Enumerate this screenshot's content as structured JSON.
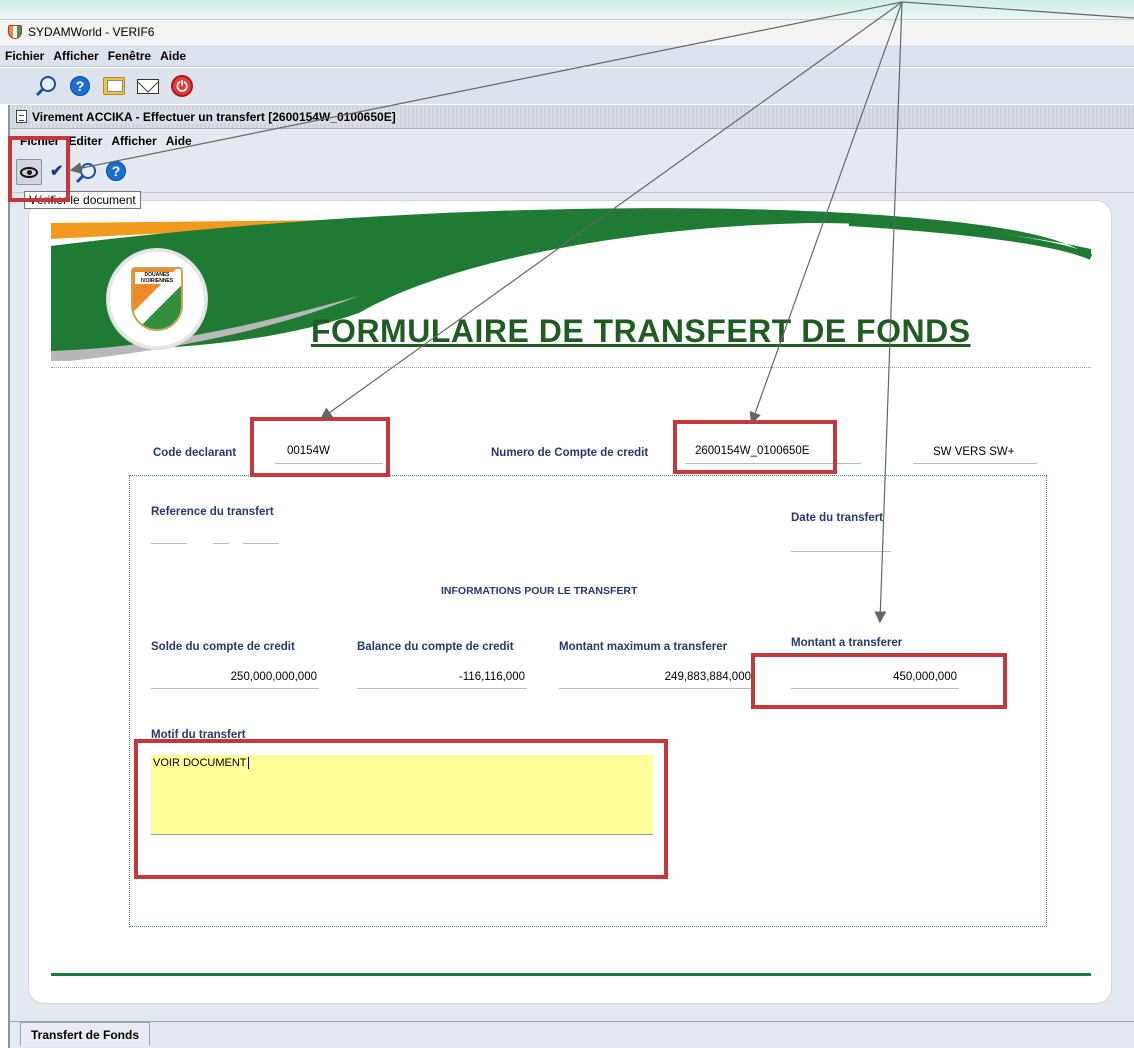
{
  "window": {
    "title": "SYDAMWorld - VERIF6"
  },
  "main_menu": {
    "items": [
      "Fichier",
      "Afficher",
      "Fenêtre",
      "Aide"
    ]
  },
  "inner_window": {
    "title": "Virement ACCIKA - Effectuer un transfert [2600154W_0100650E]",
    "menu": [
      "Fichier",
      "Editer",
      "Afficher",
      "Aide"
    ],
    "tooltip": "Vérifier le document"
  },
  "form": {
    "title": "FORMULAIRE DE TRANSFERT DE FONDS",
    "logo_text": "DOUANES IVOIRIENNES",
    "code_declarant_label": "Code declarant",
    "code_declarant_value": "00154W",
    "compte_credit_label": "Numero de Compte de credit",
    "compte_credit_value": "2600154W_0100650E",
    "sw_label": "SW VERS SW+",
    "reference_label": "Reference du transfert",
    "date_label": "Date du transfert",
    "section_header": "INFORMATIONS POUR LE TRANSFERT",
    "solde_label": "Solde du compte de credit",
    "solde_value": "250,000,000,000",
    "balance_label": "Balance du compte de credit",
    "balance_value": "-116,116,000",
    "max_label": "Montant maximum a transferer",
    "max_value": "249,883,884,000",
    "montant_label": "Montant a transferer",
    "montant_value": "450,000,000",
    "motif_label": "Motif du transfert",
    "motif_value": "VOIR DOCUMENT"
  },
  "bottom_tab": {
    "label": "Transfert de Fonds"
  },
  "colors": {
    "annotation_red": "#c4373c",
    "form_green": "#205c22",
    "label_blue": "#243a6b",
    "motif_yellow": "#ffff99"
  }
}
